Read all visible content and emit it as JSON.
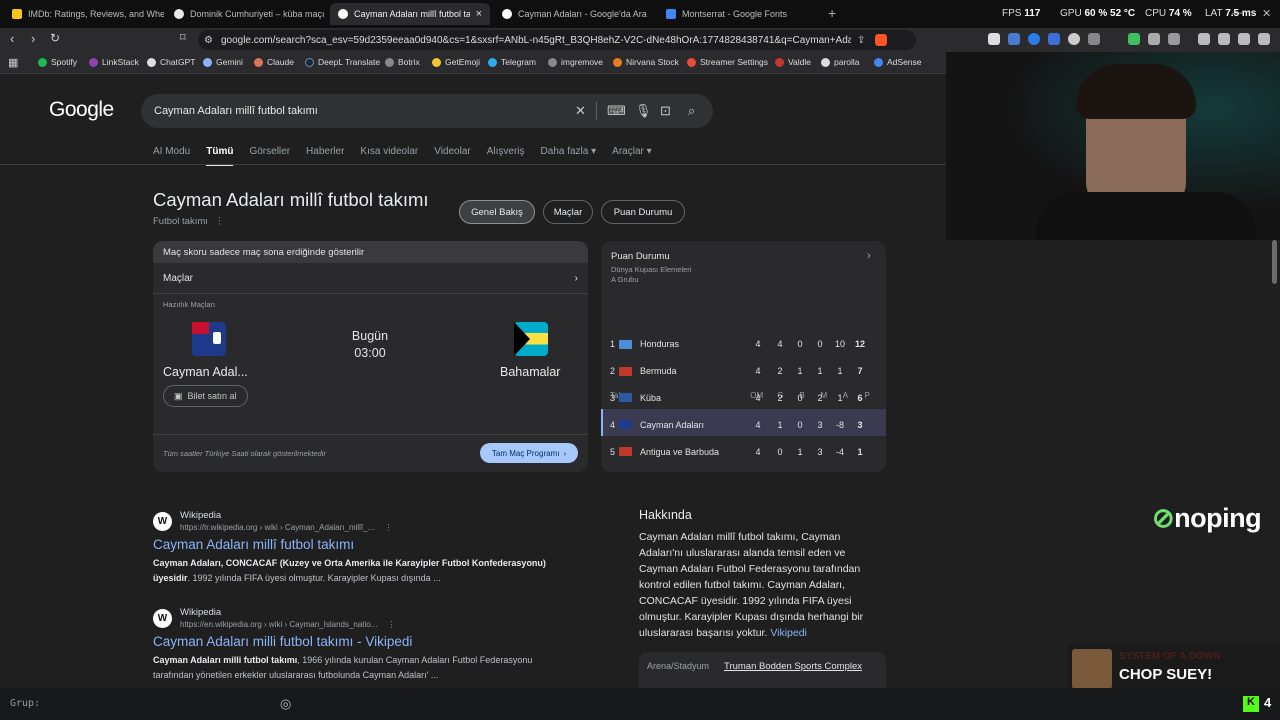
{
  "tabs": [
    {
      "title": "IMDb: Ratings, Reviews, and Where t",
      "active": false,
      "favicon_color": "#f5c518"
    },
    {
      "title": "Dominik Cumhuriyeti – küba maçı - G",
      "active": false,
      "favicon_color": "#e8e8e8"
    },
    {
      "title": "Cayman Adaları millî futbol takımı",
      "active": true,
      "favicon_color": "#ffffff"
    },
    {
      "title": "Cayman Adaları - Google'da Ara",
      "active": false,
      "favicon_color": "#ffffff"
    },
    {
      "title": "Montserrat - Google Fonts",
      "active": false,
      "favicon_color": "#4285f4"
    }
  ],
  "tab_close": "×",
  "new_tab": "+",
  "stats": {
    "fps_label": "FPS",
    "fps": "117",
    "gpu_label": "GPU",
    "gpu": "60 %",
    "gpu_temp": "52 °C",
    "cpu_label": "CPU",
    "cpu": "74 %",
    "lat_label": "LAT",
    "lat": "7.5 ms"
  },
  "window_controls": {
    "minimize": "—",
    "close": "✕"
  },
  "toolbar": {
    "url": "google.com/search?sca_esv=59d2359eeaa0d940&cs=1&sxsrf=ANbL-n45gRt_B3QH8ehZ-V2C-dNe48hOrA:1774828438741&q=Cayman+Adaları+millî..."
  },
  "bookmarks": [
    {
      "label": "Spotify",
      "color": "#1db954"
    },
    {
      "label": "LinkStack",
      "color": "#8e44ad"
    },
    {
      "label": "ChatGPT",
      "color": "#dddddd"
    },
    {
      "label": "Gemini",
      "color": "#8ab4f8"
    },
    {
      "label": "Claude",
      "color": "#d97757"
    },
    {
      "label": "DeepL Translate",
      "color": "#0f2b46"
    },
    {
      "label": "Botrix",
      "color": "#888888"
    },
    {
      "label": "GetEmoji",
      "color": "#f4c430"
    },
    {
      "label": "Telegram",
      "color": "#2aabee"
    },
    {
      "label": "imgremove",
      "color": "#888888"
    },
    {
      "label": "Nirvana Stock",
      "color": "#e67e22"
    },
    {
      "label": "Streamer Settings",
      "color": "#e74c3c"
    },
    {
      "label": "Valdle",
      "color": "#c0392b"
    },
    {
      "label": "parolla",
      "color": "#dddddd"
    },
    {
      "label": "AdSense",
      "color": "#4285f4"
    }
  ],
  "google": {
    "logo": "Google",
    "query": "Cayman Adaları millî futbol takımı",
    "nav_tabs": [
      "AI Modu",
      "Tümü",
      "Görseller",
      "Haberler",
      "Kısa videolar",
      "Videolar",
      "Alışveriş",
      "Dahafazla",
      "Araçlar"
    ],
    "nav_more": "Daha fazla",
    "active_tab": "Tümü"
  },
  "panel": {
    "title": "Cayman Adaları millî futbol takımı",
    "subtitle": "Futbol takımı",
    "pills": [
      "Genel Bakış",
      "Maçlar",
      "Puan Durumu"
    ]
  },
  "match_card": {
    "notice": "Maç skoru sadece maç sona erdiğinde gösterilir",
    "section": "Maçlar",
    "label": "Hazırlık Maçları",
    "home": "Cayman Adal...",
    "away": "Bahamalar",
    "day": "Bugün",
    "time": "03:00",
    "ticket": "Bilet satın al",
    "footer": "Tüm saatler Türkiye Saati olarak gösterilmektedir",
    "schedule_button": "Tam Maç Programı"
  },
  "standings": {
    "title": "Puan Durumu",
    "competition": "Dünya Kupası Elemeleri",
    "group": "A Grubu",
    "headers": [
      "Takım",
      "OM",
      "G",
      "B",
      "M",
      "A",
      "P"
    ],
    "rows": [
      {
        "pos": "1",
        "team": "Honduras",
        "om": "4",
        "g": "4",
        "b": "0",
        "m": "0",
        "a": "10",
        "p": "12",
        "flag": "#4a90d9"
      },
      {
        "pos": "2",
        "team": "Bermuda",
        "om": "4",
        "g": "2",
        "b": "1",
        "m": "1",
        "a": "1",
        "p": "7",
        "flag": "#c0392b"
      },
      {
        "pos": "3",
        "team": "Küba",
        "om": "4",
        "g": "2",
        "b": "0",
        "m": "2",
        "a": "1",
        "p": "6",
        "flag": "#2c5aa0"
      },
      {
        "pos": "4",
        "team": "Cayman Adaları",
        "om": "4",
        "g": "1",
        "b": "0",
        "m": "3",
        "a": "-8",
        "p": "3",
        "flag": "#1f3a8a"
      },
      {
        "pos": "5",
        "team": "Antigua ve Barbuda",
        "om": "4",
        "g": "0",
        "b": "1",
        "m": "3",
        "a": "-4",
        "p": "1",
        "flag": "#c0392b"
      }
    ],
    "highlight_row": 3
  },
  "results": [
    {
      "source": "Wikipedia",
      "url": "https://tr.wikipedia.org › wiki › Cayman_Adaları_millî_...",
      "title": "Cayman Adaları millî futbol takımı",
      "snippet_bold": "Cayman Adaları, CONCACAF (Kuzey ve Orta Amerika ile Karayipler Futbol Konfederasyonu) üyesidir",
      "snippet": ". 1992 yılında FIFA üyesi olmuştur. Karayipler Kupası dışında ..."
    },
    {
      "source": "Wikipedia",
      "url": "https://en.wikipedia.org › wiki › Cayman_Islands_natio...",
      "title": "Cayman Adaları milli futbol takımı - Vikipedi",
      "snippet_bold": "Cayman Adaları milli futbol takımı",
      "snippet": ", 1966 yılında kurulan Cayman Adaları Futbol Federasyonu tarafından yönetilen erkekler uluslararası futbolunda Cayman Adaları' ..."
    }
  ],
  "about": {
    "title": "Hakkında",
    "text": "Cayman Adaları millî futbol takımı, Cayman Adaları'nı uluslararası alanda temsil eden ve Cayman Adaları Futbol Federasyonu tarafından kontrol edilen futbol takımı. Cayman Adaları, CONCACAF üyesidir. 1992 yılında FIFA üyesi olmuştur. Karayipler Kupası dışında herhangi bir uluslararası başarısı yoktur.",
    "link": "Vikipedi",
    "stadium_label": "Arena/Stadyum",
    "stadium": "Truman Bodden Sports Complex"
  },
  "overlay": {
    "sponsor": "noping",
    "music_artist": "SYSTEM OF A DOWN",
    "music_title": "CHOP SUEY!",
    "chat_label": "Grup:"
  }
}
